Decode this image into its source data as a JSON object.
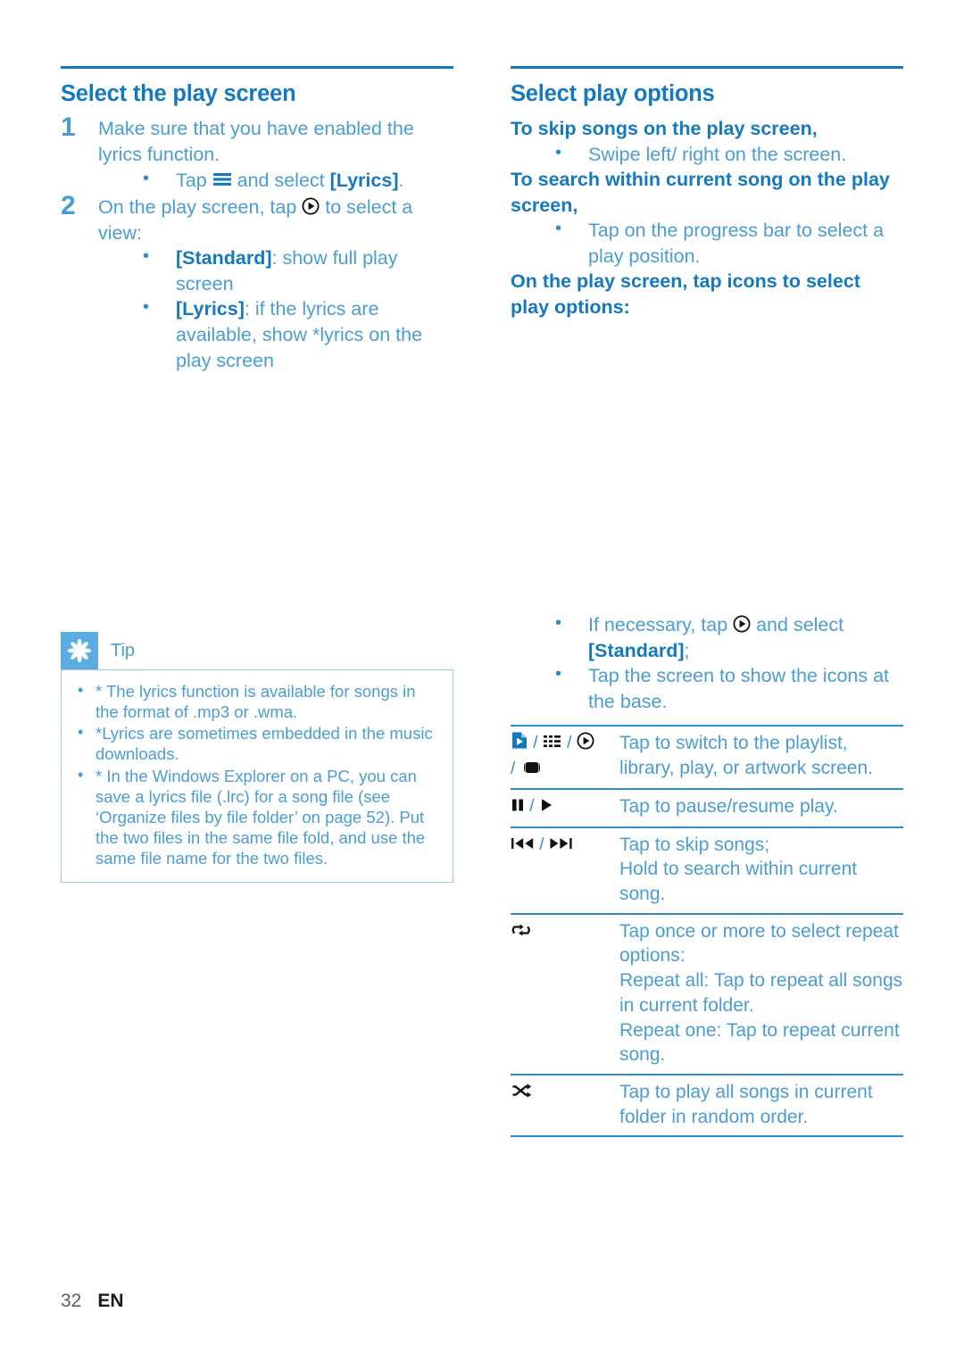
{
  "accent": {
    "heading_blue": "#1579BE",
    "body_blue": "#4A9DD4",
    "rule_blue": "#2E8CCB",
    "tip_badge": "#5BADE0",
    "tip_border": "#9ACDEB"
  },
  "left_column": {
    "title": "Select the play screen",
    "steps": [
      {
        "number": "1",
        "text": "Make sure that you have enabled the lyrics function.",
        "bullets": [
          {
            "pre": "Tap ",
            "icon": "menu-icon",
            "mid": " and select ",
            "strong": "[Lyrics]",
            "post": "."
          }
        ]
      },
      {
        "number": "2",
        "pre": "On the play screen, tap ",
        "icon": "play-circle-icon",
        "post": " to select a view:",
        "bullets": [
          {
            "strong": "[Standard]",
            "post": ": show full play screen"
          },
          {
            "strong": "[Lyrics]",
            "post": ": if the lyrics are available, show *lyrics on the play screen"
          }
        ]
      }
    ]
  },
  "tip": {
    "badge_icon": "asterisk-icon",
    "label": "Tip",
    "items": [
      "* The lyrics function is available for songs in the format of .mp3 or .wma.",
      "*Lyrics are sometimes embedded in the music downloads.",
      "* In the Windows Explorer on a PC, you can save a lyrics file (.lrc) for a song file (see ‘Organize files by file folder’ on page 52). Put the two files in the same file fold, and use the same file name for the two files."
    ]
  },
  "right_column": {
    "title": "Select play options",
    "blocks": [
      {
        "lead": "To skip songs on the play screen,",
        "bullets": [
          {
            "text": "Swipe left/ right on the screen."
          }
        ]
      },
      {
        "lead": "To search within current song on the play screen,",
        "bullets": [
          {
            "text": "Tap on the progress bar to select a play position."
          }
        ]
      },
      {
        "lead": "On the play screen, tap icons to select play options:",
        "bullets": []
      }
    ],
    "pre_table_bullets": [
      {
        "pre": "If necessary, tap ",
        "icon": "play-circle-icon",
        "mid": " and select ",
        "strong": "[Standard]",
        "post": ";"
      },
      {
        "text": "Tap the screen to show the icons at the base."
      }
    ]
  },
  "icon_table": {
    "rows": [
      {
        "icons": [
          "playlist-icon",
          "library-grid-icon",
          "play-circle-icon",
          "artwork-icon"
        ],
        "icon_layout": "playlist / library / play / artwork",
        "description": "Tap to switch to the playlist, library, play, or artwork screen."
      },
      {
        "icons": [
          "pause-icon",
          "play-icon"
        ],
        "icon_layout": "pause / play",
        "description": "Tap to pause/resume play."
      },
      {
        "icons": [
          "previous-icon",
          "next-icon"
        ],
        "icon_layout": "previous / next",
        "description_lines": [
          "Tap to skip songs;",
          "Hold to search within current song."
        ]
      },
      {
        "icons": [
          "repeat-icon"
        ],
        "icon_layout": "repeat",
        "description_lines": [
          "Tap once or more to select repeat options:",
          "Repeat all: Tap to repeat all songs in current folder.",
          "Repeat one: Tap to repeat current song."
        ]
      },
      {
        "icons": [
          "shuffle-icon"
        ],
        "icon_layout": "shuffle",
        "description": "Tap to play all songs in current folder in random order."
      }
    ]
  },
  "footer": {
    "page_number": "32",
    "language": "EN"
  }
}
